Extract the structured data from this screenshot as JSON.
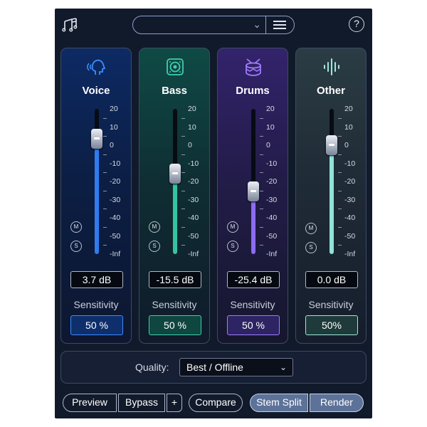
{
  "header": {
    "preset_value": "",
    "help_label": "?"
  },
  "stems": [
    {
      "name": "Voice",
      "icon": "voice-head-icon",
      "value_text": "3.7 dB",
      "level_db": 3.7,
      "sensitivity_label": "Sensitivity",
      "sensitivity_value": "50 %",
      "mute_label": "M",
      "solo_label": "S",
      "accent": "#2f7cf0"
    },
    {
      "name": "Bass",
      "icon": "speaker-icon",
      "value_text": "-15.5 dB",
      "level_db": -15.5,
      "sensitivity_label": "Sensitivity",
      "sensitivity_value": "50 %",
      "mute_label": "M",
      "solo_label": "S",
      "accent": "#33c4a0"
    },
    {
      "name": "Drums",
      "icon": "drum-icon",
      "value_text": "-25.4 dB",
      "level_db": -25.4,
      "sensitivity_label": "Sensitivity",
      "sensitivity_value": "50 %",
      "mute_label": "M",
      "solo_label": "S",
      "accent": "#8c6cf2"
    },
    {
      "name": "Other",
      "icon": "waveform-icon",
      "value_text": "0.0 dB",
      "level_db": 0.0,
      "sensitivity_label": "Sensitivity",
      "sensitivity_value": "50%",
      "mute_label": "M",
      "solo_label": "S",
      "accent": "#8fe3d7"
    }
  ],
  "scale_labels": [
    "20",
    "10",
    "0",
    "-10",
    "-20",
    "-30",
    "-40",
    "-50",
    "-Inf"
  ],
  "quality": {
    "label": "Quality:",
    "value": "Best / Offline"
  },
  "footer": {
    "preview": "Preview",
    "bypass": "Bypass",
    "plus": "+",
    "compare": "Compare",
    "stem_split": "Stem Split",
    "render": "Render"
  }
}
